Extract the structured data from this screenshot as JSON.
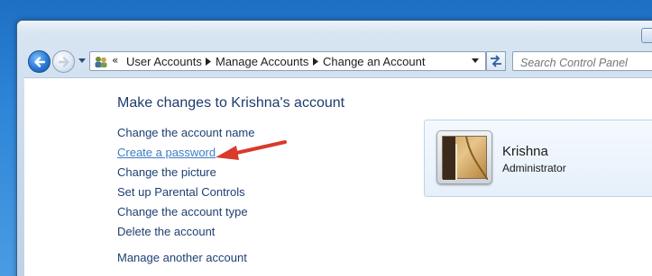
{
  "toolbar": {
    "breadcrumbs": [
      "User Accounts",
      "Manage Accounts",
      "Change an Account"
    ],
    "overflow_chevron": "«",
    "search_placeholder": "Search Control Panel"
  },
  "main": {
    "heading": "Make changes to Krishna's account",
    "tasks": [
      {
        "label": "Change the account name"
      },
      {
        "label": "Create a password",
        "highlighted": true
      },
      {
        "label": "Change the picture"
      },
      {
        "label": "Set up Parental Controls"
      },
      {
        "label": "Change the account type"
      },
      {
        "label": "Delete the account"
      }
    ],
    "other_link": "Manage another account"
  },
  "account_card": {
    "name": "Krishna",
    "role": "Administrator",
    "picture_icon": "guitar-picture"
  },
  "annotation": {
    "icon": "red-arrow-icon",
    "color": "#d93a2b"
  },
  "colors": {
    "link": "#1d3f73",
    "heading": "#1e3c6e",
    "highlight_link": "#3d7cc4"
  }
}
